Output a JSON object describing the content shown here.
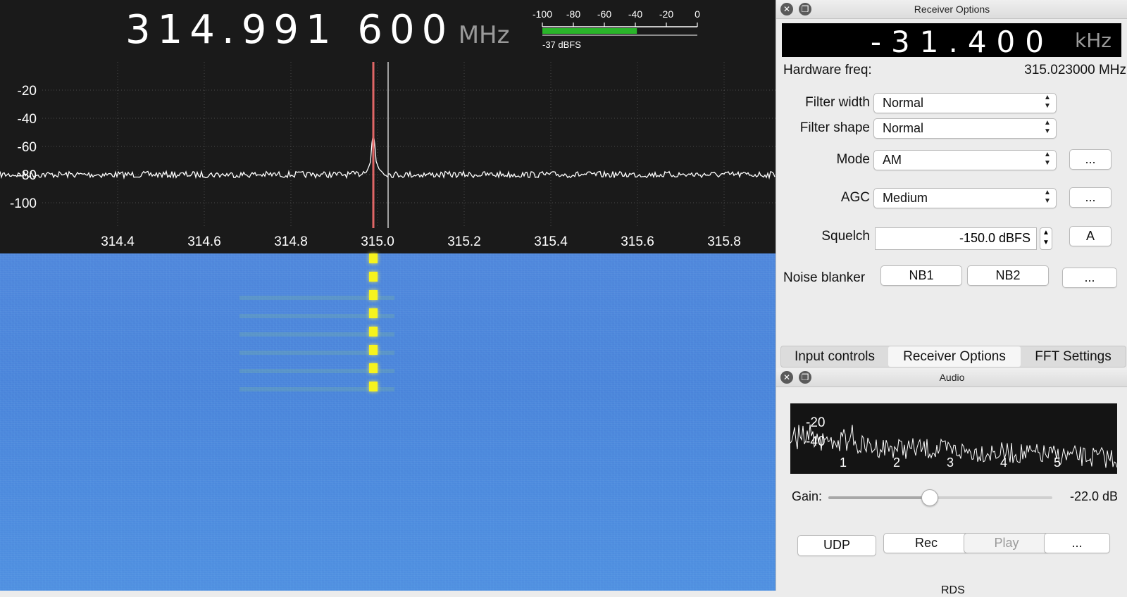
{
  "frequency": {
    "value": "314.991 600",
    "unit": "MHz"
  },
  "smeter": {
    "tick_labels": [
      "-100",
      "-80",
      "-60",
      "-40",
      "-20",
      "0"
    ],
    "level_fraction": 0.61,
    "reading": "-37 dBFS",
    "bar_color": "#2ab52a"
  },
  "spectrum": {
    "y_labels": [
      "-20",
      "-40",
      "-60",
      "-80",
      "-100"
    ],
    "x_labels": [
      "314.4",
      "314.6",
      "314.8",
      "315.0",
      "315.2",
      "315.4",
      "315.6",
      "315.8"
    ],
    "trace_color": "#ffffff",
    "tuned_marker_color": "#e06666"
  },
  "waterfall": {
    "background_color": "#4a82d9",
    "signal_color": "#f6f31e"
  },
  "receiver_options": {
    "title": "Receiver Options",
    "offset": {
      "value": "-31.400",
      "unit": "kHz"
    },
    "hardware_freq": {
      "label": "Hardware freq:",
      "value": "315.023000 MHz"
    },
    "filter_width": {
      "label": "Filter width",
      "value": "Normal"
    },
    "filter_shape": {
      "label": "Filter shape",
      "value": "Normal"
    },
    "mode": {
      "label": "Mode",
      "value": "AM",
      "more": "..."
    },
    "agc": {
      "label": "AGC",
      "value": "Medium",
      "more": "..."
    },
    "squelch": {
      "label": "Squelch",
      "value": "-150.0 dBFS",
      "auto": "A"
    },
    "noise_blanker": {
      "label": "Noise blanker",
      "nb1": "NB1",
      "nb2": "NB2",
      "more": "..."
    }
  },
  "tabs": [
    {
      "label": "Input controls",
      "active": false
    },
    {
      "label": "Receiver Options",
      "active": true
    },
    {
      "label": "FFT Settings",
      "active": false
    }
  ],
  "audio": {
    "title": "Audio",
    "fft_y_labels": [
      "-20",
      "-40"
    ],
    "fft_x_labels": [
      "1",
      "2",
      "3",
      "4",
      "5"
    ],
    "gain": {
      "label": "Gain:",
      "value": "-22.0 dB",
      "level_fraction": 0.45
    },
    "buttons": {
      "udp": "UDP",
      "rec": "Rec",
      "play": "Play",
      "more": "..."
    }
  },
  "next_panel_title": "RDS"
}
